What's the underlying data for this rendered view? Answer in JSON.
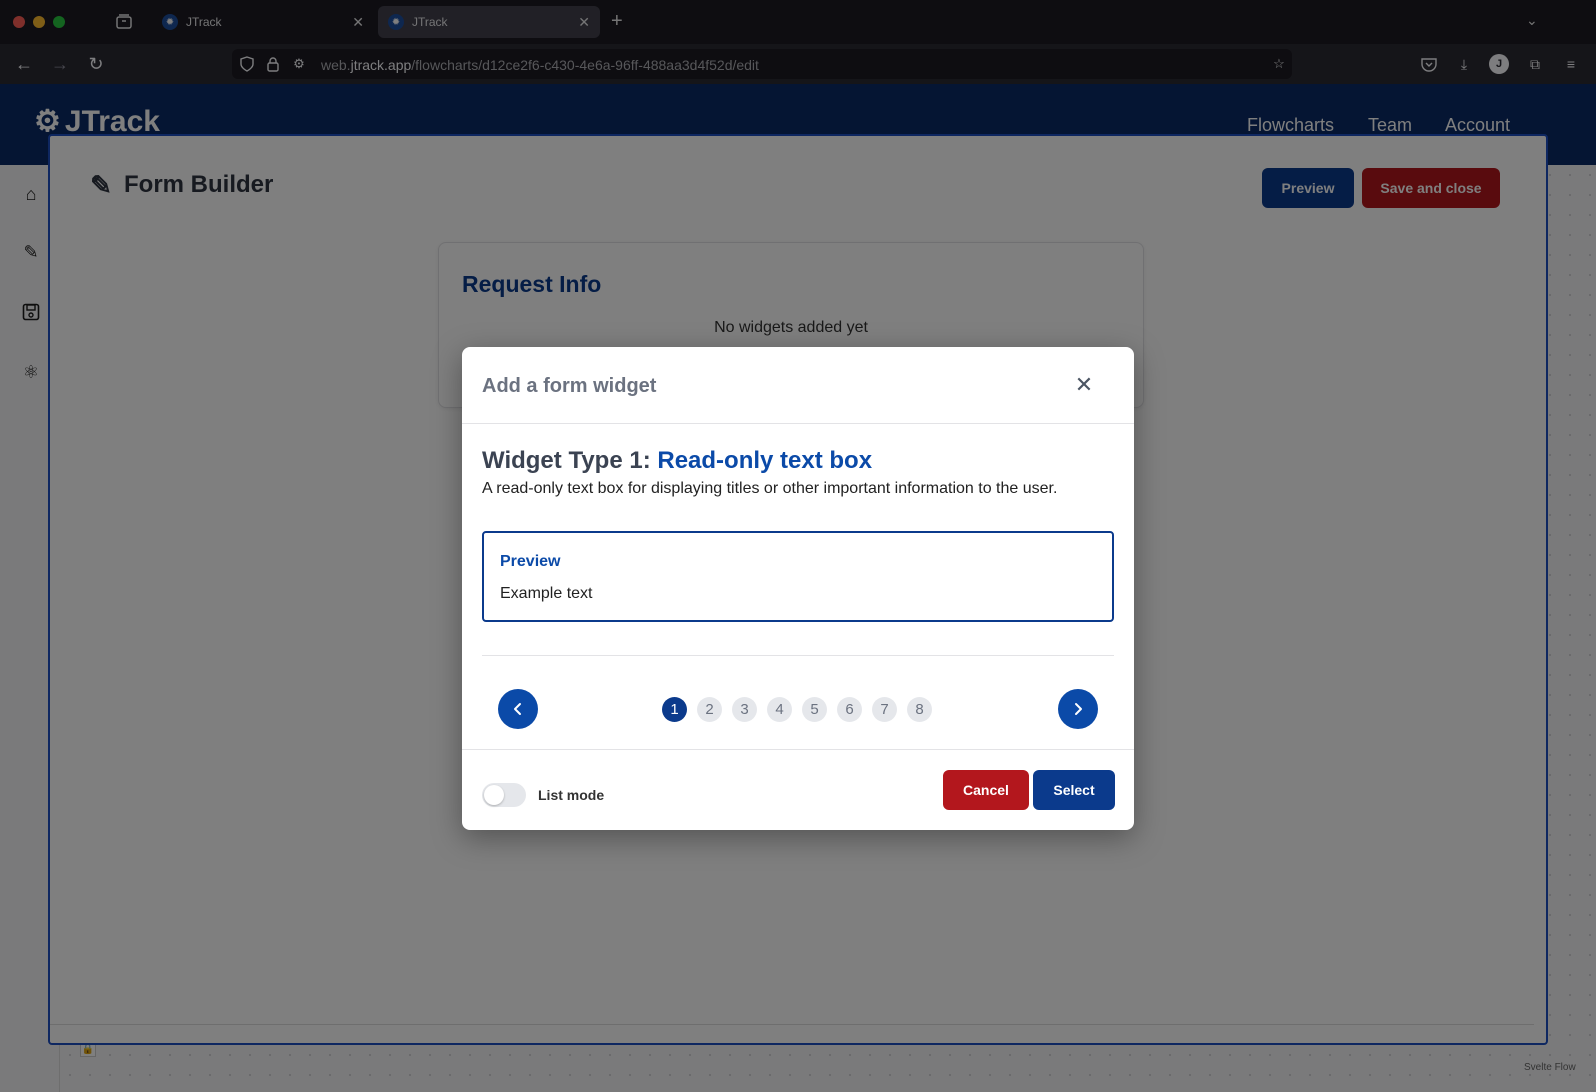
{
  "browser": {
    "tabs": [
      {
        "title": "JTrack"
      },
      {
        "title": "JTrack"
      }
    ],
    "url_prefix": "web.",
    "url_host": "jtrack.app",
    "url_path": "/flowcharts/d12ce2f6-c430-4e6a-96ff-488aa3d4f52d/edit",
    "profile_initial": "J"
  },
  "app": {
    "logo": "JTrack",
    "nav": [
      "Flowcharts",
      "Team",
      "Account"
    ],
    "footer_credit": "Svelte Flow"
  },
  "builder": {
    "title": "Form Builder",
    "preview_label": "Preview",
    "save_label": "Save and close",
    "card_title": "Request Info",
    "empty_text": "No widgets added yet"
  },
  "modal": {
    "title": "Add a form widget",
    "widget_prefix": "Widget Type 1:",
    "widget_name": "Read-only text box",
    "description": "A read-only text box for displaying titles or other important information to the user.",
    "preview_label": "Preview",
    "preview_text": "Example text",
    "pages": [
      "1",
      "2",
      "3",
      "4",
      "5",
      "6",
      "7",
      "8"
    ],
    "active_page": "1",
    "list_mode_label": "List mode",
    "list_mode_on": false,
    "cancel_label": "Cancel",
    "select_label": "Select"
  },
  "colors": {
    "primary": "#0b3a8c",
    "danger": "#b3171d",
    "header_bg": "#0b2b66"
  }
}
